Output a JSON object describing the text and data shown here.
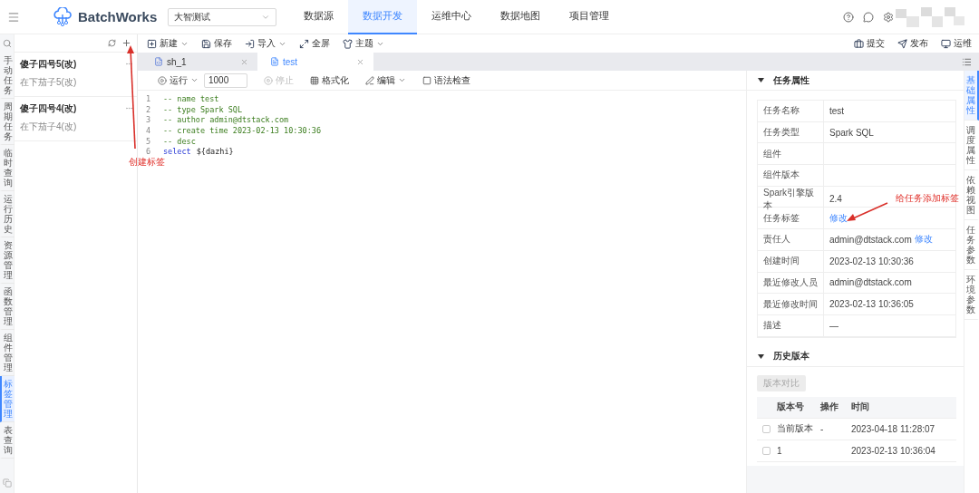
{
  "header": {
    "app_name": "BatchWorks",
    "project_select": "大智测试",
    "nav": [
      {
        "label": "数据源",
        "selected": false
      },
      {
        "label": "数据开发",
        "selected": true
      },
      {
        "label": "运维中心",
        "selected": false
      },
      {
        "label": "数据地图",
        "selected": false
      },
      {
        "label": "项目管理",
        "selected": false
      }
    ]
  },
  "side_nav": [
    {
      "label": "手动任务",
      "selected": false
    },
    {
      "label": "周期任务",
      "selected": false
    },
    {
      "label": "临时查询",
      "selected": false
    },
    {
      "label": "运行历史",
      "selected": false
    },
    {
      "label": "资源管理",
      "selected": false
    },
    {
      "label": "函数管理",
      "selected": false
    },
    {
      "label": "组件管理",
      "selected": false
    },
    {
      "label": "标签管理",
      "selected": true
    },
    {
      "label": "表查询",
      "selected": false
    }
  ],
  "tag_list": [
    {
      "title": "傻子四号5(改)",
      "subtitle": "在下茄子5(改)"
    },
    {
      "title": "傻子四号4(改)",
      "subtitle": "在下茄子4(改)"
    }
  ],
  "toolbar": {
    "left": [
      {
        "label": "新建",
        "kind": "new",
        "dropdown": true
      },
      {
        "label": "保存",
        "kind": "save",
        "dropdown": false
      },
      {
        "label": "导入",
        "kind": "import",
        "dropdown": true
      },
      {
        "label": "全屏",
        "kind": "fullscreen",
        "dropdown": false
      },
      {
        "label": "主题",
        "kind": "theme",
        "dropdown": true
      }
    ],
    "right": [
      {
        "label": "提交",
        "kind": "submit"
      },
      {
        "label": "发布",
        "kind": "publish"
      },
      {
        "label": "运维",
        "kind": "ops"
      }
    ]
  },
  "tabs": [
    {
      "label": "sh_1",
      "kind": "shell",
      "selected": false
    },
    {
      "label": "test",
      "kind": "sql",
      "selected": true
    }
  ],
  "editor_toolbar": {
    "run": "运行",
    "limit": "1000",
    "stop": "停止",
    "stop_disabled": true,
    "format": "格式化",
    "edit": "编辑",
    "check": "语法检查"
  },
  "code": [
    {
      "number": "1",
      "tokens": [
        {
          "kind": "comment",
          "text": "-- name test"
        }
      ]
    },
    {
      "number": "2",
      "tokens": [
        {
          "kind": "comment",
          "text": "-- type Spark SQL"
        }
      ]
    },
    {
      "number": "3",
      "tokens": [
        {
          "kind": "comment",
          "text": "-- author admin@dtstack.com"
        }
      ]
    },
    {
      "number": "4",
      "tokens": [
        {
          "kind": "comment",
          "text": "-- create time 2023-02-13 10:30:36"
        }
      ]
    },
    {
      "number": "5",
      "tokens": [
        {
          "kind": "comment",
          "text": "-- desc"
        }
      ]
    },
    {
      "number": "6",
      "tokens": [
        {
          "kind": "keyword",
          "text": "select"
        },
        {
          "kind": "plain",
          "text": "${dazhi}"
        }
      ]
    }
  ],
  "properties": {
    "title": "任务属性",
    "rows": [
      {
        "label": "任务名称",
        "value": "test"
      },
      {
        "label": "任务类型",
        "value": "Spark SQL"
      },
      {
        "label": "组件"
      },
      {
        "label": "组件版本"
      },
      {
        "label": "Spark引擎版本",
        "value": "2.4"
      },
      {
        "label": "任务标签",
        "link": "修改"
      },
      {
        "label": "责任人",
        "value": "admin@dtstack.com",
        "link": "修改"
      },
      {
        "label": "创建时间",
        "value": "2023-02-13 10:30:36"
      },
      {
        "label": "最近修改人员",
        "value": "admin@dtstack.com"
      },
      {
        "label": "最近修改时间",
        "value": "2023-02-13 10:36:05"
      },
      {
        "label": "描述",
        "value": "—"
      }
    ]
  },
  "history": {
    "title": "历史版本",
    "compare_button": "版本对比",
    "compare_disabled": true,
    "columns": [
      "版本号",
      "操作",
      "时间"
    ],
    "rows": [
      {
        "version": "当前版本",
        "action": "-",
        "time": "2023-04-18 11:28:07",
        "checked": false
      },
      {
        "version": "1",
        "time": "2023-02-13 10:36:04",
        "checked": false
      }
    ]
  },
  "right_tabs": [
    {
      "label": "基础属性",
      "selected": true
    },
    {
      "label": "调度属性",
      "selected": false
    },
    {
      "label": "依赖视图",
      "selected": false
    },
    {
      "label": "任务参数",
      "selected": false
    },
    {
      "label": "环境参数",
      "selected": false
    }
  ],
  "annotations": [
    "创建标签",
    "给任务添加标签"
  ]
}
